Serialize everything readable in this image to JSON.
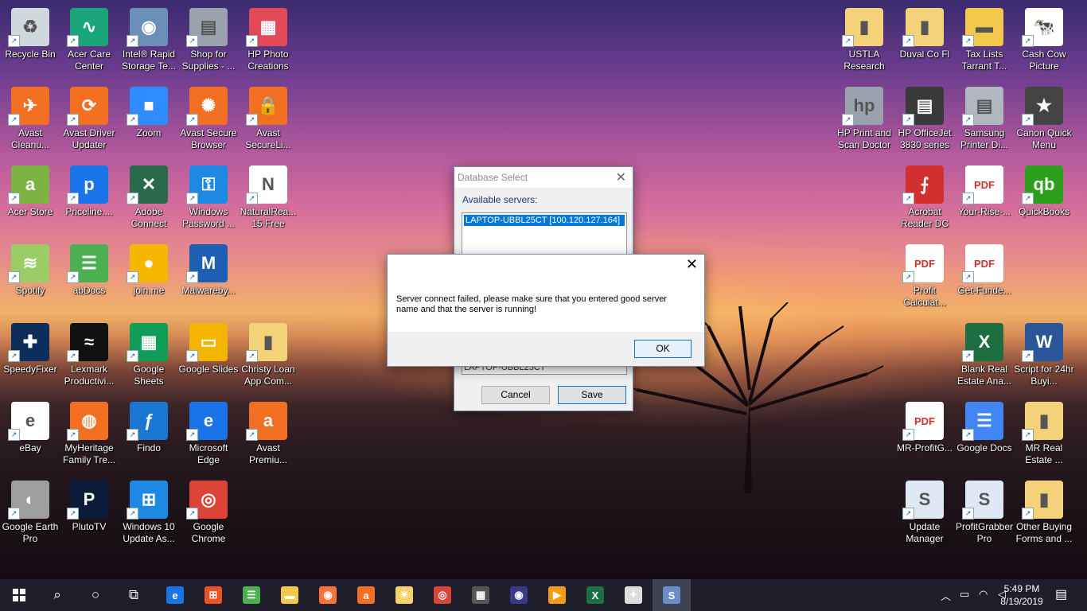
{
  "desktop_icons_left": [
    {
      "label": "Recycle Bin",
      "icon": "recycle-bin-icon",
      "color": "#cfd8dc",
      "glyph": "♻"
    },
    {
      "label": "Acer Care Center",
      "icon": "acer-care-icon",
      "color": "#1aa57a",
      "glyph": "∿"
    },
    {
      "label": "Intel® Rapid Storage Te...",
      "icon": "intel-storage-icon",
      "color": "#6b8fb8",
      "glyph": "◉"
    },
    {
      "label": "Shop for Supplies - ...",
      "icon": "printer-shop-icon",
      "color": "#9aa3ad",
      "glyph": "▤"
    },
    {
      "label": "HP Photo Creations",
      "icon": "hp-photo-icon",
      "color": "#e24a5a",
      "glyph": "▦"
    },
    {
      "label": "Avast Cleanu...",
      "icon": "avast-cleanup-icon",
      "color": "#f36f21",
      "glyph": "✈"
    },
    {
      "label": "Avast Driver Updater",
      "icon": "avast-driver-icon",
      "color": "#f36f21",
      "glyph": "⟳"
    },
    {
      "label": "Zoom",
      "icon": "zoom-icon",
      "color": "#2d8cff",
      "glyph": "■"
    },
    {
      "label": "Avast Secure Browser",
      "icon": "avast-browser-icon",
      "color": "#f36f21",
      "glyph": "✺"
    },
    {
      "label": "Avast SecureLi...",
      "icon": "avast-secureline-icon",
      "color": "#f36f21",
      "glyph": "🔒"
    },
    {
      "label": "Acer Store",
      "icon": "acer-store-icon",
      "color": "#7cb342",
      "glyph": "a"
    },
    {
      "label": "Priceline....",
      "icon": "priceline-icon",
      "color": "#1a73e8",
      "glyph": "p"
    },
    {
      "label": "Adobe Connect",
      "icon": "adobe-connect-icon",
      "color": "#2a6a4a",
      "glyph": "✕"
    },
    {
      "label": "Windows Password ...",
      "icon": "windows-password-icon",
      "color": "#1e88e5",
      "glyph": "⚿"
    },
    {
      "label": "NaturalRea... 15 Free",
      "icon": "naturalreader-icon",
      "color": "#ffffff",
      "glyph": "N"
    },
    {
      "label": "Spotify",
      "icon": "spotify-icon",
      "color": "#9ccc65",
      "glyph": "≋"
    },
    {
      "label": "abDocs",
      "icon": "abdocs-icon",
      "color": "#4caf50",
      "glyph": "☰"
    },
    {
      "label": "join.me",
      "icon": "joinme-icon",
      "color": "#f5b700",
      "glyph": "●"
    },
    {
      "label": "Malwareby...",
      "icon": "malwarebytes-icon",
      "color": "#1e5fb4",
      "glyph": "M"
    },
    {
      "label": "SpeedyFixer",
      "icon": "speedyfixer-icon",
      "color": "#0d2d5a",
      "glyph": "✚"
    },
    {
      "label": "Lexmark Productivi...",
      "icon": "lexmark-icon",
      "color": "#111111",
      "glyph": "≈"
    },
    {
      "label": "Google Sheets",
      "icon": "google-sheets-icon",
      "color": "#0f9d58",
      "glyph": "▦"
    },
    {
      "label": "Google Slides",
      "icon": "google-slides-icon",
      "color": "#f4b400",
      "glyph": "▭"
    },
    {
      "label": "Christy Loan App Com...",
      "icon": "zip-folder-icon",
      "color": "#f3d27a",
      "glyph": "▮"
    },
    {
      "label": "eBay",
      "icon": "ebay-icon",
      "color": "#ffffff",
      "glyph": "e"
    },
    {
      "label": "MyHeritage Family Tre...",
      "icon": "myheritage-icon",
      "color": "#f36f21",
      "glyph": "◍"
    },
    {
      "label": "Findo",
      "icon": "findo-icon",
      "color": "#1976d2",
      "glyph": "ƒ"
    },
    {
      "label": "Microsoft Edge",
      "icon": "edge-icon",
      "color": "#1a73e8",
      "glyph": "e"
    },
    {
      "label": "Avast Premiu...",
      "icon": "avast-premium-icon",
      "color": "#f36f21",
      "glyph": "a"
    },
    {
      "label": "Google Earth Pro",
      "icon": "google-earth-icon",
      "color": "#9e9e9e",
      "glyph": "◐"
    },
    {
      "label": "PlutoTV",
      "icon": "plutotv-icon",
      "color": "#0b1b3a",
      "glyph": "P"
    },
    {
      "label": "Windows 10 Update As...",
      "icon": "windows-update-icon",
      "color": "#1e88e5",
      "glyph": "⊞"
    },
    {
      "label": "Google Chrome",
      "icon": "chrome-icon",
      "color": "#db4437",
      "glyph": "◎"
    }
  ],
  "desktop_icons_right": [
    {
      "label": "USTLA Research",
      "icon": "zip-folder-icon",
      "color": "#f3d27a",
      "glyph": "▮"
    },
    {
      "label": "Duval Co Fl",
      "icon": "zip-folder-icon",
      "color": "#f3d27a",
      "glyph": "▮"
    },
    {
      "label": "Tax Lists Tarrant T...",
      "icon": "folder-icon",
      "color": "#f3c74a",
      "glyph": "▬"
    },
    {
      "label": "Cash Cow Picture",
      "icon": "cash-cow-icon",
      "color": "#ffffff",
      "glyph": "🐄"
    },
    {
      "label": "HP Print and Scan Doctor",
      "icon": "hp-doctor-icon",
      "color": "#9aa3ad",
      "glyph": "hp"
    },
    {
      "label": "HP OfficeJet 3830 series",
      "icon": "hp-printer-icon",
      "color": "#3a3a3a",
      "glyph": "▤"
    },
    {
      "label": "Samsung Printer Di...",
      "icon": "samsung-printer-icon",
      "color": "#b0b7bf",
      "glyph": "▤"
    },
    {
      "label": "Canon Quick Menu",
      "icon": "canon-menu-icon",
      "color": "#444444",
      "glyph": "★"
    },
    {
      "label": "Acrobat Reader DC",
      "icon": "acrobat-icon",
      "color": "#d32f2f",
      "glyph": "⨍"
    },
    {
      "label": "Your-Rise-...",
      "icon": "pdf-file-icon",
      "color": "#ffffff",
      "glyph": "PDF"
    },
    {
      "label": "QuickBooks",
      "icon": "quickbooks-icon",
      "color": "#2ca01c",
      "glyph": "qb"
    },
    {
      "label": "Profit Calculat...",
      "icon": "pdf-file-icon",
      "color": "#ffffff",
      "glyph": "PDF"
    },
    {
      "label": "Get-Funde...",
      "icon": "pdf-file-icon",
      "color": "#ffffff",
      "glyph": "PDF"
    },
    {
      "label": "Blank Real Estate Ana...",
      "icon": "excel-file-icon",
      "color": "#1d6f42",
      "glyph": "X"
    },
    {
      "label": "Script for 24hr Buyi...",
      "icon": "word-file-icon",
      "color": "#2b579a",
      "glyph": "W"
    },
    {
      "label": "MR-ProfitG...",
      "icon": "pdf-file-icon",
      "color": "#ffffff",
      "glyph": "PDF"
    },
    {
      "label": "Google Docs",
      "icon": "google-docs-icon",
      "color": "#4285f4",
      "glyph": "☰"
    },
    {
      "label": "MR Real Estate ...",
      "icon": "zip-folder-icon",
      "color": "#f3d27a",
      "glyph": "▮"
    },
    {
      "label": "Update Manager",
      "icon": "update-manager-icon",
      "color": "#dfe8f5",
      "glyph": "S"
    },
    {
      "label": "ProfitGrabber Pro",
      "icon": "profitgrabber-icon",
      "color": "#dfe8f5",
      "glyph": "S"
    },
    {
      "label": "Other Buying Forms and ...",
      "icon": "zip-folder-icon",
      "color": "#f3d27a",
      "glyph": "▮"
    }
  ],
  "db_dialog": {
    "title": "Database Select",
    "available_label": "Available servers:",
    "selected_server": "LAPTOP-UBBL25CT [100.120.127.164]",
    "server_field_value": "LAPTOP-UBBL25CT",
    "cancel_label": "Cancel",
    "save_label": "Save"
  },
  "error_dialog": {
    "message": "Server connect failed, please make sure that you entered good server name and that the server is running!",
    "ok_label": "OK"
  },
  "taskbar": {
    "time": "5:49 PM",
    "date": "8/19/2019",
    "apps": [
      {
        "icon": "file-explorer-icon",
        "color": "#f3c74a",
        "glyph": "▬"
      },
      {
        "icon": "firefox-icon",
        "color": "#ff7139",
        "glyph": "◉"
      },
      {
        "icon": "avast-icon",
        "color": "#f36f21",
        "glyph": "a"
      },
      {
        "icon": "sun-app-icon",
        "color": "#f7d36b",
        "glyph": "☀"
      },
      {
        "icon": "chrome-icon",
        "color": "#db4437",
        "glyph": "◎"
      },
      {
        "icon": "calculator-icon",
        "color": "#555555",
        "glyph": "▦"
      },
      {
        "icon": "eye-app-icon",
        "color": "#3b3b8a",
        "glyph": "◉"
      },
      {
        "icon": "media-player-icon",
        "color": "#f39c12",
        "glyph": "▶"
      },
      {
        "icon": "excel-icon",
        "color": "#1d6f42",
        "glyph": "X"
      },
      {
        "icon": "lightbulb-icon",
        "color": "#dddddd",
        "glyph": "✦"
      },
      {
        "icon": "profitgrabber-icon",
        "color": "#6a8fc8",
        "glyph": "S"
      }
    ]
  }
}
